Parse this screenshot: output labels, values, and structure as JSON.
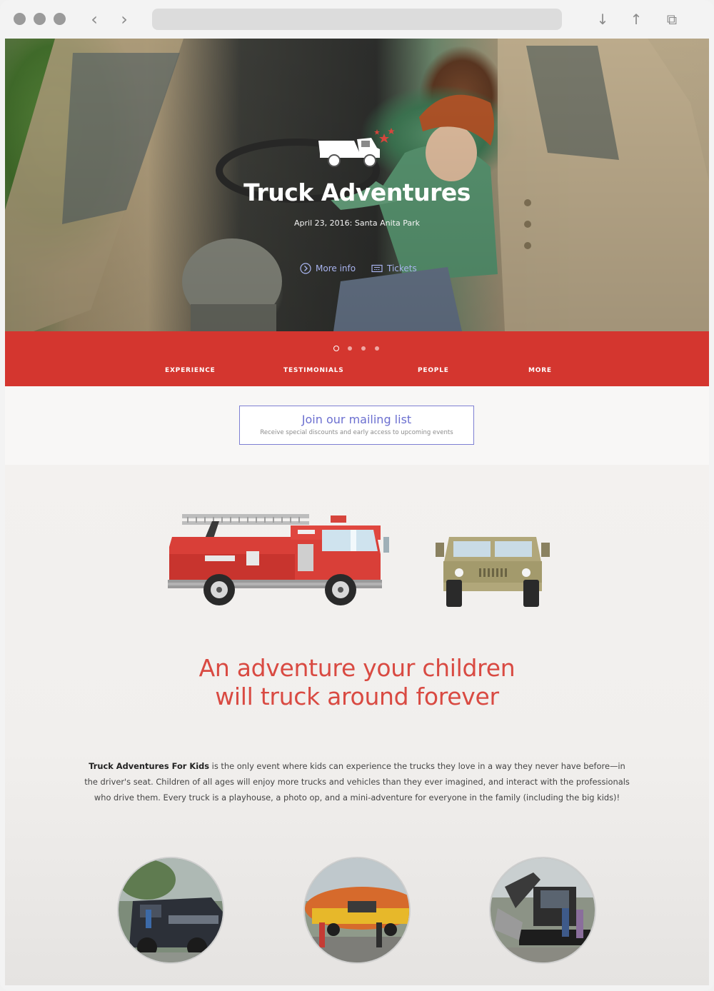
{
  "browser": {
    "back_glyph": "‹",
    "forward_glyph": "›",
    "download_glyph": "↓",
    "share_glyph": "↑",
    "tabs_glyph": "⧉"
  },
  "hero": {
    "title": "Truck Adventures",
    "subtitle": "April 23, 2016: Santa Anita Park",
    "more_info_label": "More info",
    "tickets_label": "Tickets",
    "icon": "dump-truck-icon"
  },
  "carousel": {
    "total": 4,
    "active": 1
  },
  "nav": {
    "items": [
      {
        "label": "EXPERIENCE"
      },
      {
        "label": "TESTIMONIALS"
      },
      {
        "label": "PEOPLE"
      },
      {
        "label": "MORE"
      }
    ]
  },
  "mailing": {
    "title": "Join our mailing list",
    "subtitle": "Receive special discounts and early access to upcoming events"
  },
  "feature": {
    "headline_line1": "An adventure your children",
    "headline_line2": "will truck around forever",
    "body_bold": "Truck Adventures For Kids",
    "body_rest": " is the only event where kids can experience the trucks they love in a way they never have before—in the driver's seat. Children of all ages will enjoy more trucks and vehicles than they ever imagined, and interact with the professionals who drive them. Every truck is a playhouse, a photo op, and a mini-adventure for everyone in the family (including the big kids)!"
  },
  "gallery": [
    {
      "name": "police-truck-photo"
    },
    {
      "name": "hotdog-car-photo"
    },
    {
      "name": "excavator-photo"
    }
  ],
  "colors": {
    "brand_red": "#d4362f",
    "headline_red": "#d94a42",
    "accent_blue": "#6b6fd0"
  }
}
